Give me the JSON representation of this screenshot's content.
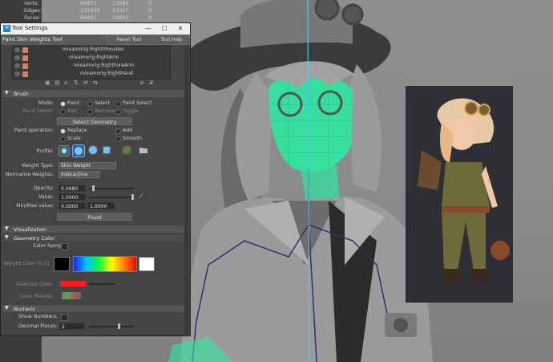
{
  "viewport": {
    "stats": [
      {
        "label": "Verts:",
        "v1": "65871",
        "v2": "11882",
        "v3": "0"
      },
      {
        "label": "Edges:",
        "v1": "132038",
        "v2": "21927",
        "v3": "0"
      },
      {
        "label": "Faces:",
        "v1": "66881",
        "v2": "10892",
        "v3": "0"
      }
    ]
  },
  "window": {
    "title": "Tool Settings",
    "tool_name": "Paint Skin Weights Tool",
    "reset_label": "Reset Tool",
    "help_label": "Tool Help",
    "min": "—",
    "max": "☐",
    "close": "✕"
  },
  "joints": [
    "mixamorig:RightShoulder",
    "mixamorig:RightArm",
    "mixamorig:RightForeArm",
    "mixamorig:RightHand"
  ],
  "brush": {
    "section": "Brush",
    "mode_label": "Mode:",
    "mode_options": [
      "Paint",
      "Select",
      "Paint Select"
    ],
    "paint_select_label": "Paint Select:",
    "paint_select_options": [
      "Add",
      "Remove",
      "Toggle"
    ],
    "select_geometry": "Select Geometry",
    "paint_operation_label": "Paint operation:",
    "ops": [
      "Replace",
      "Add",
      "Scale",
      "Smooth"
    ],
    "profile_label": "Profile:",
    "weight_type_label": "Weight Type:",
    "weight_type": "Skin Weight",
    "normalize_label": "Normalize Weights:",
    "normalize": "Interactive",
    "opacity_label": "Opacity:",
    "opacity": "0.0680",
    "value_label": "Value:",
    "value": "1.0000",
    "minmax_label": "Min/Max value:",
    "min": "0.0000",
    "max": "1.0000",
    "flood": "Flood"
  },
  "visualization": {
    "section": "Visualization",
    "geom_section": "Geometry Color",
    "color_ramp_label": "Color Ramp:",
    "weight_color_label": "Weight Color (0-1):",
    "selected_color_label": "Selected Color:",
    "selected_color": "#ff1a1a",
    "color_presets_label": "Color Presets:"
  },
  "numeric": {
    "section": "Numeric",
    "show_numbers_label": "Show Numbers:",
    "decimal_label": "Decimal Places:",
    "decimal": "2"
  },
  "colors": {
    "accent": "#2a7fd4",
    "mesh_green": "#2ee8a0",
    "skeleton": "#3a2a6e",
    "joint_swatch": "#d07f62"
  }
}
